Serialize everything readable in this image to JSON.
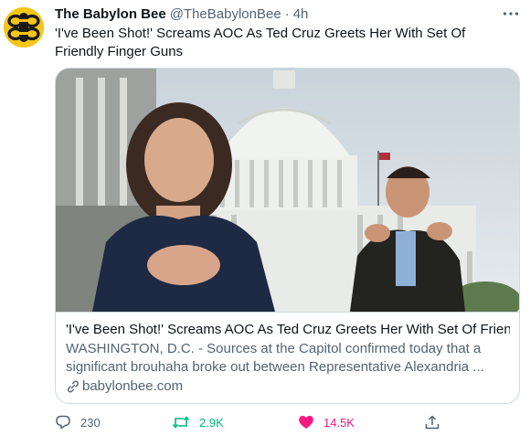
{
  "tweet": {
    "author_name": "The Babylon Bee",
    "handle": "@TheBabylonBee",
    "separator": "·",
    "time": "4h",
    "text": "'I've Been Shot!' Screams AOC As Ted Cruz Greets Her With Set Of Friendly Finger Guns"
  },
  "icons": {
    "avatar": "babylon-bee-logo",
    "more": "more-dots-icon",
    "link": "link-icon",
    "reply": "reply-icon",
    "retweet": "retweet-icon",
    "like": "heart-icon",
    "share": "share-icon"
  },
  "card": {
    "title": "'I've Been Shot!' Screams AOC As Ted Cruz Greets Her With Set Of Frien...",
    "description_lines": [
      "WASHINGTON, D.C. - Sources at the Capitol confirmed today that a",
      "significant brouhaha broke out between Representative Alexandria ..."
    ],
    "domain": "babylonbee.com"
  },
  "actions": {
    "replies": "230",
    "retweets": "2.9K",
    "likes": "14.5K"
  },
  "colors": {
    "retweet_active": "#00ba7c",
    "like_active": "#f91880",
    "secondary_text": "#536471",
    "border": "#cfd9de",
    "avatar_bg": "#f5c518"
  }
}
